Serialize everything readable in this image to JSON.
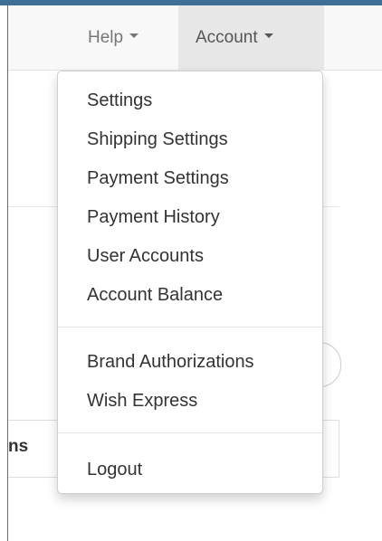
{
  "nav": {
    "help_label": "Help",
    "account_label": "Account"
  },
  "background": {
    "table_header_label": "ns"
  },
  "dropdown": {
    "group1": [
      {
        "label": "Settings"
      },
      {
        "label": "Shipping Settings"
      },
      {
        "label": "Payment Settings"
      },
      {
        "label": "Payment History"
      },
      {
        "label": "User Accounts"
      },
      {
        "label": "Account Balance"
      }
    ],
    "group2": [
      {
        "label": "Brand Authorizations"
      },
      {
        "label": "Wish Express"
      }
    ],
    "group3": [
      {
        "label": "Logout"
      }
    ]
  },
  "colors": {
    "top_strip": "#3f6f94",
    "navbar_bg": "#f8f8f8",
    "active_nav_bg": "#e7e7e7",
    "menu_text": "#333333",
    "nav_text": "#777777"
  },
  "icons": [
    "chevron-down-icon"
  ]
}
